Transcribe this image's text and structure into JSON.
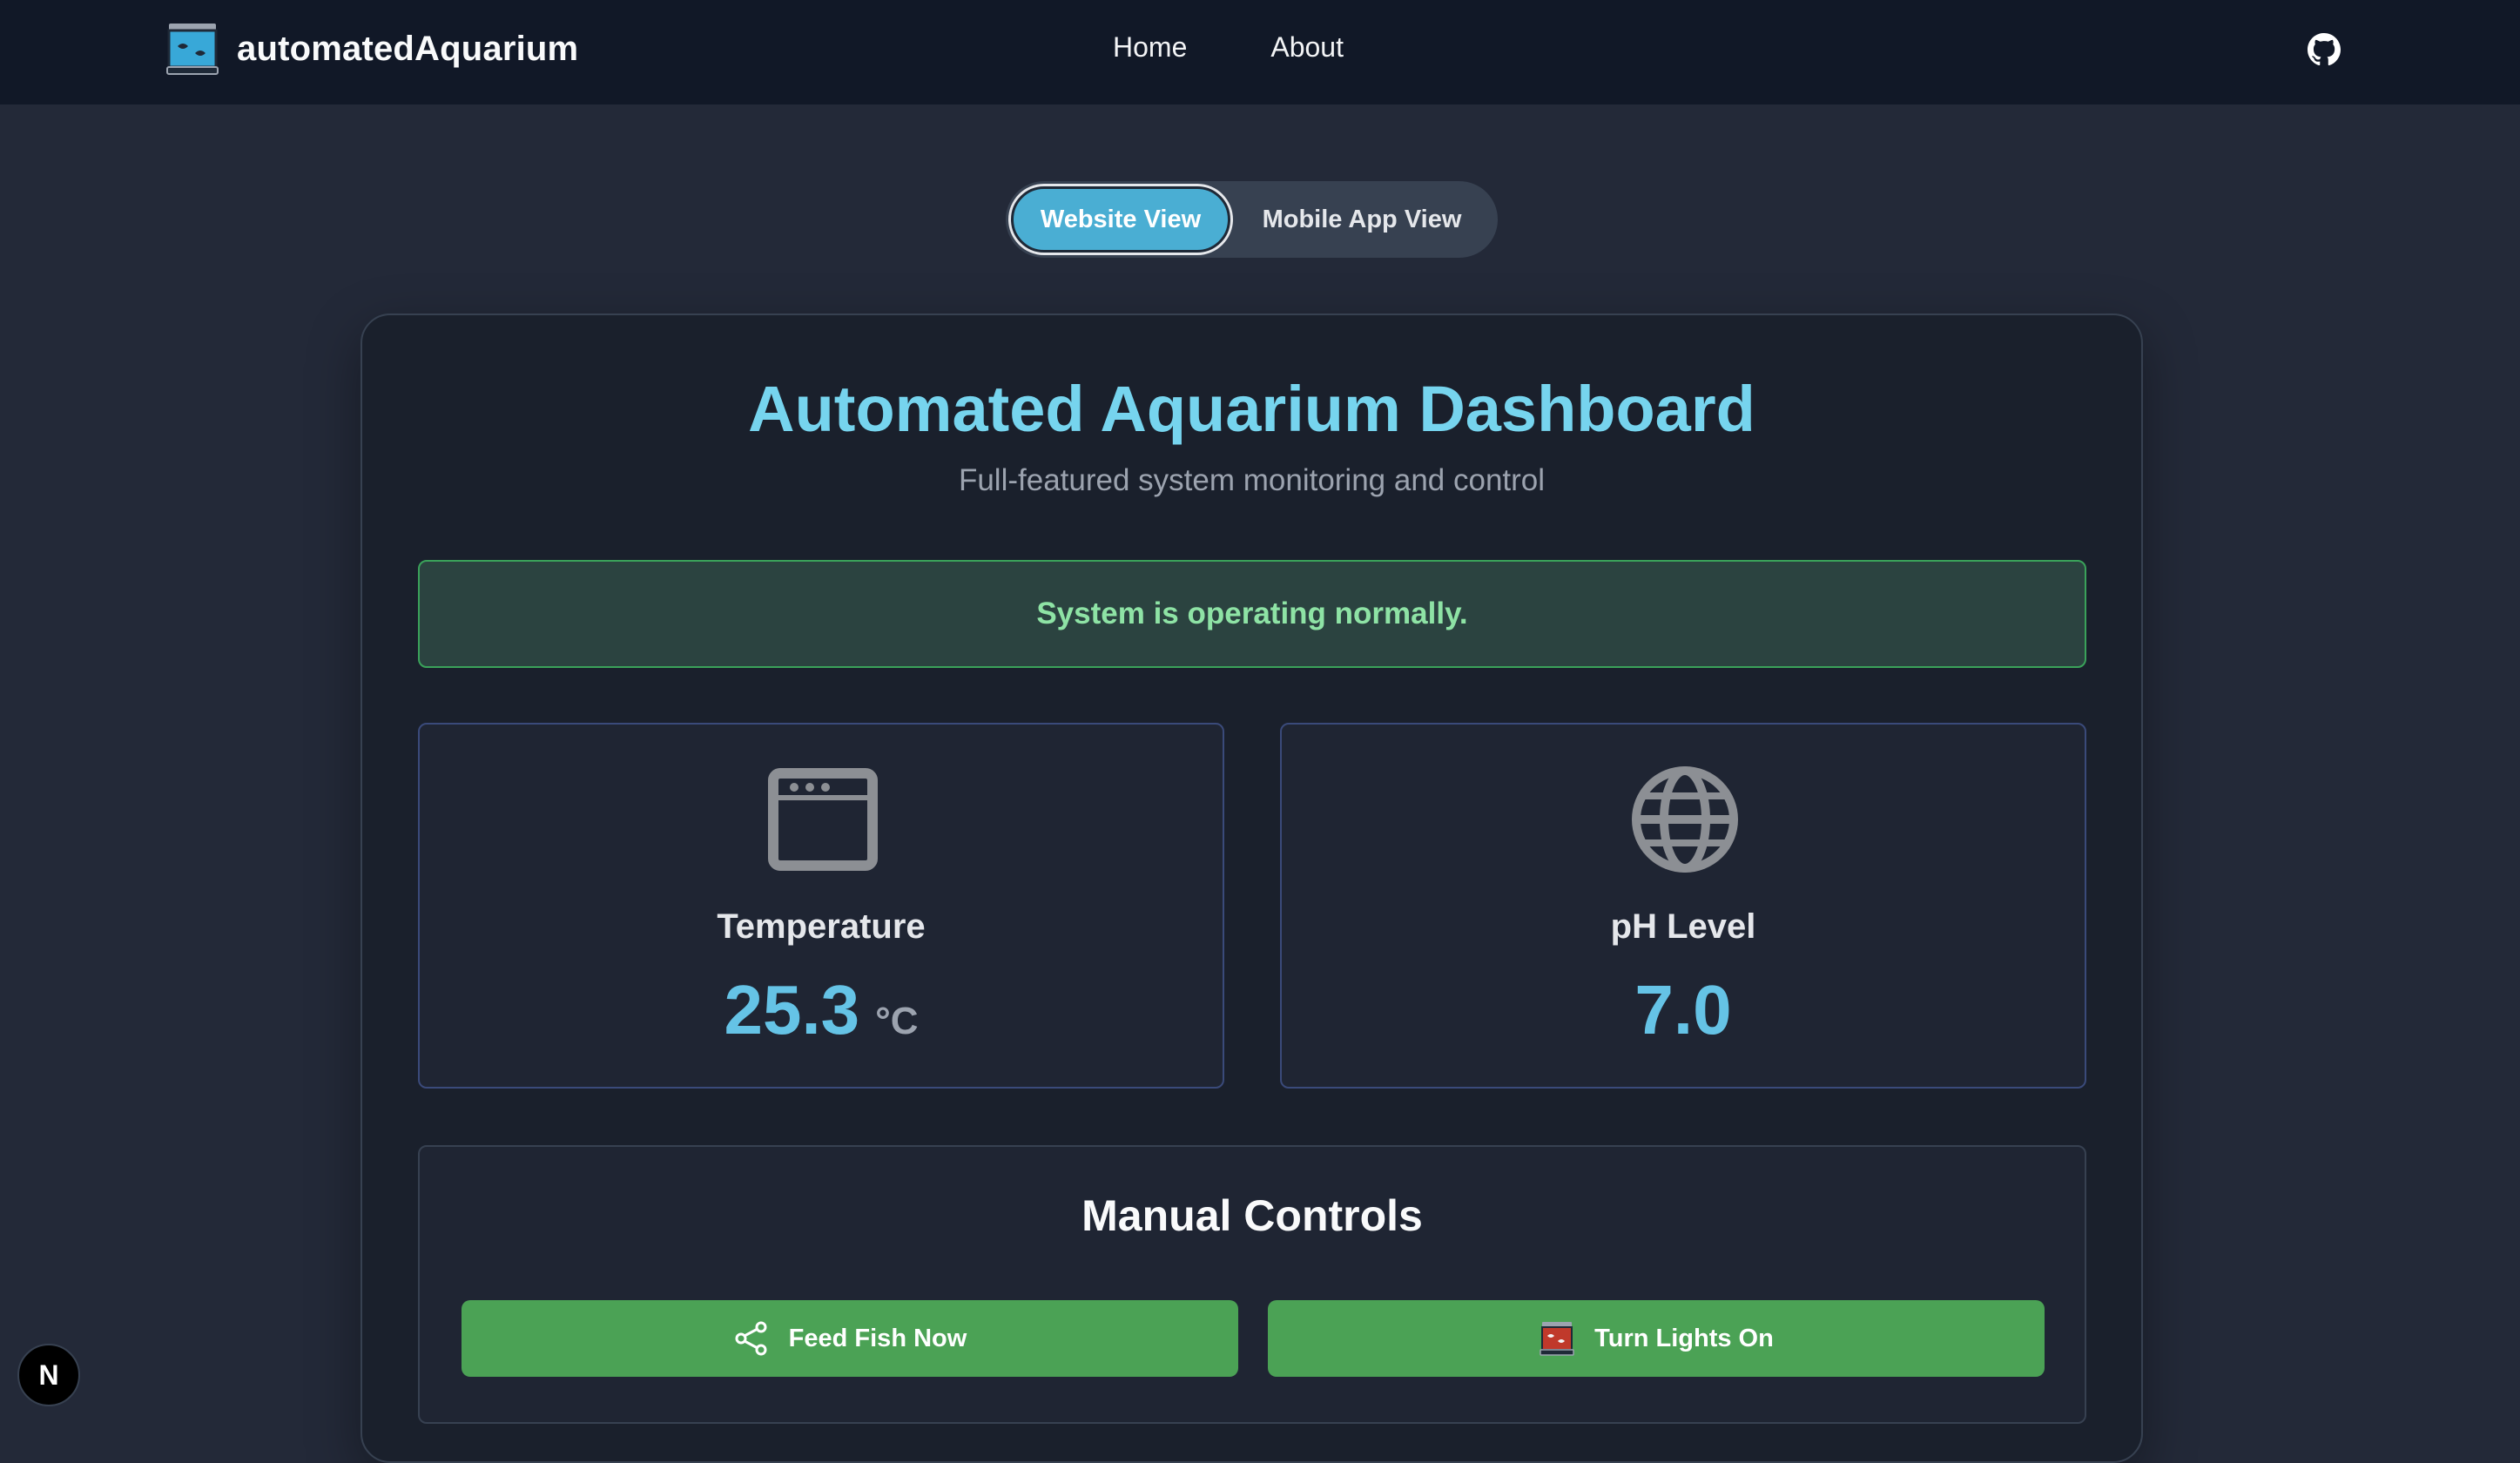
{
  "navbar": {
    "brand_name": "automatedAquarium",
    "links": [
      {
        "label": "Home"
      },
      {
        "label": "About"
      }
    ],
    "github_icon": "github-icon"
  },
  "view_toggle": {
    "active_label": "Website View",
    "inactive_label": "Mobile App View"
  },
  "dashboard": {
    "title": "Automated Aquarium Dashboard",
    "subtitle": "Full-featured system monitoring and control",
    "status_message": "System is operating normally.",
    "metrics": [
      {
        "label": "Temperature",
        "value": "25.3",
        "unit": "°C",
        "icon": "thermometer-window-icon"
      },
      {
        "label": "pH Level",
        "value": "7.0",
        "unit": "",
        "icon": "globe-icon"
      }
    ]
  },
  "controls": {
    "title": "Manual Controls",
    "feed_label": "Feed Fish Now",
    "feed_icon": "share-icon",
    "lights_label": "Turn Lights On",
    "lights_icon": "aquarium-icon"
  },
  "next_badge": {
    "label": "N"
  },
  "colors": {
    "accent": "#76d4ee",
    "value": "#65c3e6",
    "success_bg": "#2b4340",
    "success_text": "#8ee3a5",
    "button_green": "#4ba255",
    "toggle_active": "#4aaed3"
  }
}
